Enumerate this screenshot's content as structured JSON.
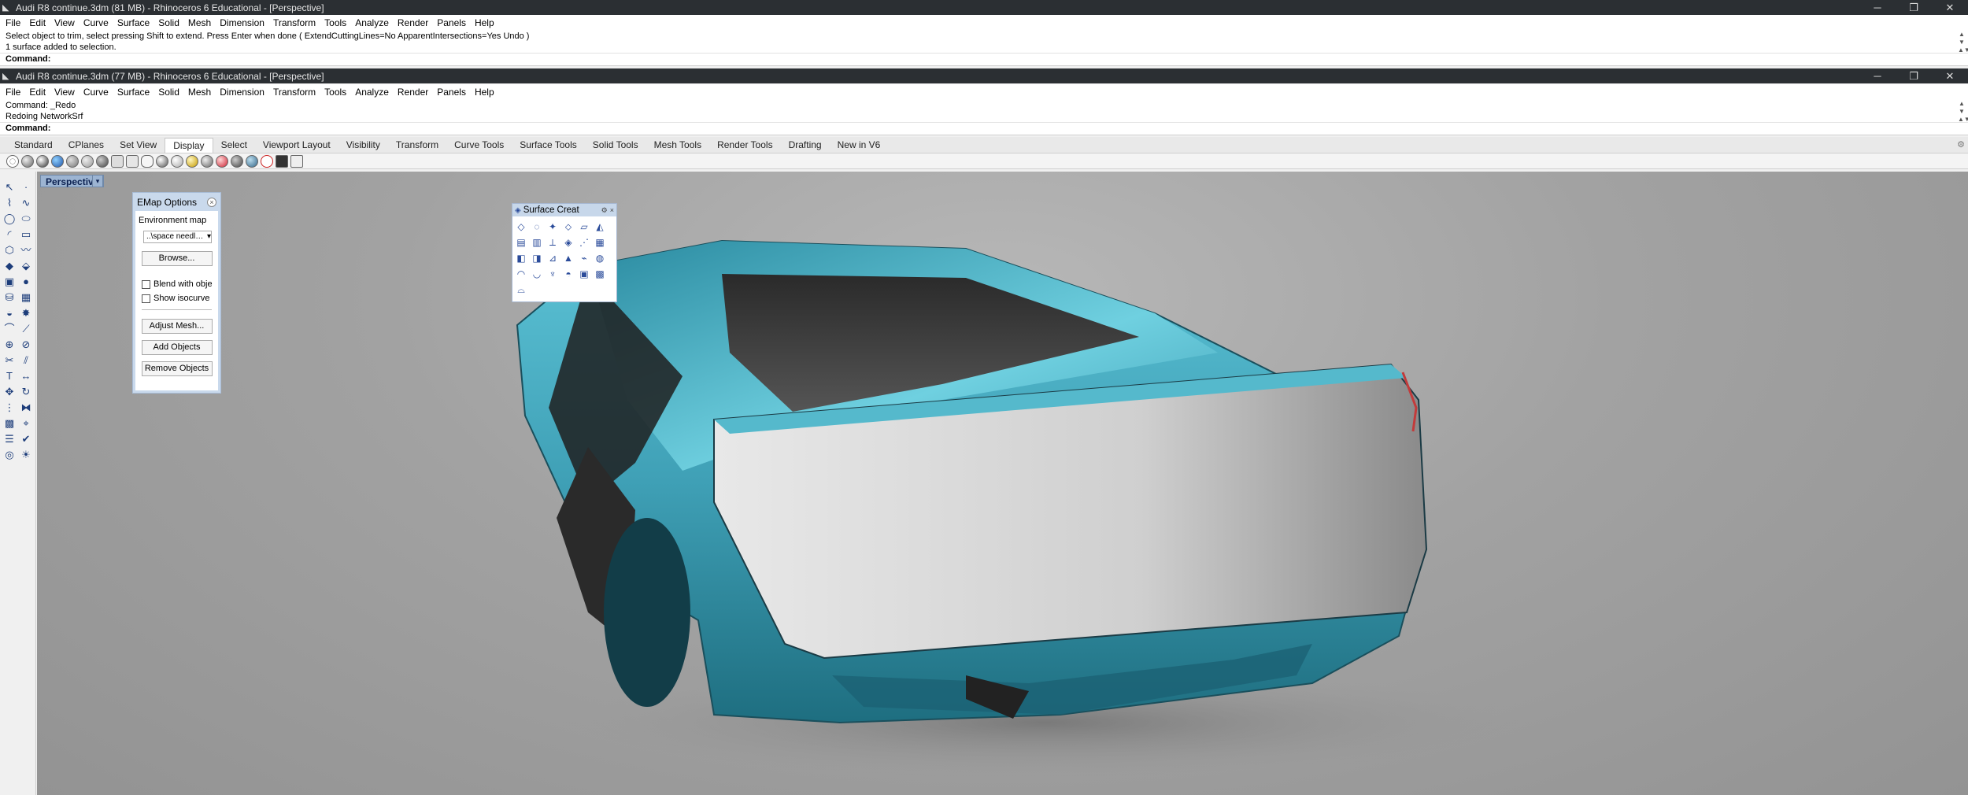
{
  "window1": {
    "title": "Audi R8 continue.3dm (81 MB) - Rhinoceros 6 Educational - [Perspective]",
    "command_history": [
      "Select object to trim, select pressing Shift to extend. Press Enter when done ( ExtendCuttingLines=No  ApparentIntersections=Yes  Undo )",
      "1 surface added to selection."
    ],
    "command_prompt": "Command:"
  },
  "window2": {
    "title": "Audi R8 continue.3dm (77 MB) - Rhinoceros 6 Educational - [Perspective]",
    "command_history": [
      "Command: _Redo",
      "Redoing NetworkSrf"
    ],
    "command_prompt": "Command:"
  },
  "window_controls": {
    "minimize": "─",
    "restore": "❐",
    "close": "✕"
  },
  "menu": [
    "File",
    "Edit",
    "View",
    "Curve",
    "Surface",
    "Solid",
    "Mesh",
    "Dimension",
    "Transform",
    "Tools",
    "Analyze",
    "Render",
    "Panels",
    "Help"
  ],
  "toolbar_tabs": [
    "Standard",
    "CPlanes",
    "Set View",
    "Display",
    "Select",
    "Viewport Layout",
    "Visibility",
    "Transform",
    "Curve Tools",
    "Surface Tools",
    "Solid Tools",
    "Mesh Tools",
    "Render Tools",
    "Drafting",
    "New in V6"
  ],
  "active_tab": "Display",
  "viewport": {
    "name": "Perspective",
    "dropdown_glyph": "▾"
  },
  "emap_panel": {
    "title": "EMap Options",
    "close_glyph": "×",
    "environment_label": "Environment map",
    "map_value": "..\\space needl…",
    "select_arrow": "▾",
    "browse_label": "Browse...",
    "blend_label": "Blend with obje",
    "isocurve_label": "Show isocurve",
    "adjust_label": "Adjust Mesh...",
    "add_label": "Add Objects",
    "remove_label": "Remove Objects"
  },
  "surface_panel": {
    "title": "Surface Creat",
    "gear_glyph": "⚙",
    "close_glyph": "×"
  },
  "colors": {
    "titlebar": "#2b2f33",
    "car_body": "#3fa0b6",
    "car_body_dark": "#1e6e80",
    "panel": "#c9d9ec",
    "active_viewport_tab": "#9cb4d2"
  }
}
